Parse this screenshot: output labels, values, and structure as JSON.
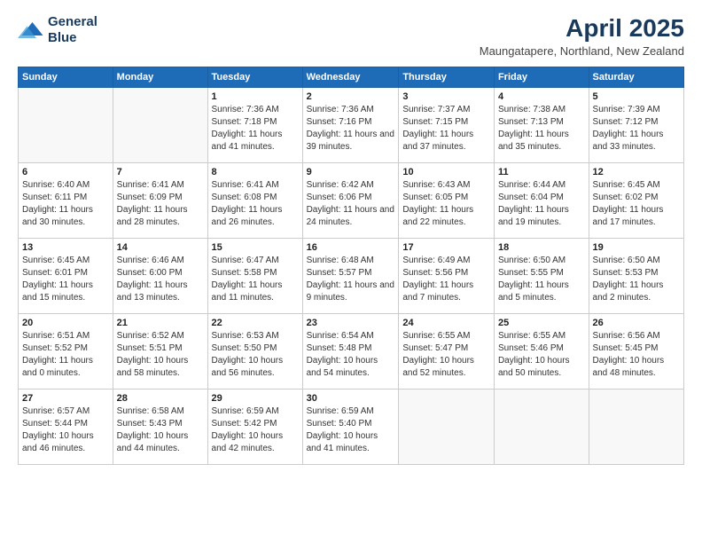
{
  "logo": {
    "line1": "General",
    "line2": "Blue"
  },
  "title": "April 2025",
  "subtitle": "Maungatapere, Northland, New Zealand",
  "headers": [
    "Sunday",
    "Monday",
    "Tuesday",
    "Wednesday",
    "Thursday",
    "Friday",
    "Saturday"
  ],
  "weeks": [
    [
      {
        "day": "",
        "info": ""
      },
      {
        "day": "",
        "info": ""
      },
      {
        "day": "1",
        "info": "Sunrise: 7:36 AM\nSunset: 7:18 PM\nDaylight: 11 hours and 41 minutes."
      },
      {
        "day": "2",
        "info": "Sunrise: 7:36 AM\nSunset: 7:16 PM\nDaylight: 11 hours and 39 minutes."
      },
      {
        "day": "3",
        "info": "Sunrise: 7:37 AM\nSunset: 7:15 PM\nDaylight: 11 hours and 37 minutes."
      },
      {
        "day": "4",
        "info": "Sunrise: 7:38 AM\nSunset: 7:13 PM\nDaylight: 11 hours and 35 minutes."
      },
      {
        "day": "5",
        "info": "Sunrise: 7:39 AM\nSunset: 7:12 PM\nDaylight: 11 hours and 33 minutes."
      }
    ],
    [
      {
        "day": "6",
        "info": "Sunrise: 6:40 AM\nSunset: 6:11 PM\nDaylight: 11 hours and 30 minutes."
      },
      {
        "day": "7",
        "info": "Sunrise: 6:41 AM\nSunset: 6:09 PM\nDaylight: 11 hours and 28 minutes."
      },
      {
        "day": "8",
        "info": "Sunrise: 6:41 AM\nSunset: 6:08 PM\nDaylight: 11 hours and 26 minutes."
      },
      {
        "day": "9",
        "info": "Sunrise: 6:42 AM\nSunset: 6:06 PM\nDaylight: 11 hours and 24 minutes."
      },
      {
        "day": "10",
        "info": "Sunrise: 6:43 AM\nSunset: 6:05 PM\nDaylight: 11 hours and 22 minutes."
      },
      {
        "day": "11",
        "info": "Sunrise: 6:44 AM\nSunset: 6:04 PM\nDaylight: 11 hours and 19 minutes."
      },
      {
        "day": "12",
        "info": "Sunrise: 6:45 AM\nSunset: 6:02 PM\nDaylight: 11 hours and 17 minutes."
      }
    ],
    [
      {
        "day": "13",
        "info": "Sunrise: 6:45 AM\nSunset: 6:01 PM\nDaylight: 11 hours and 15 minutes."
      },
      {
        "day": "14",
        "info": "Sunrise: 6:46 AM\nSunset: 6:00 PM\nDaylight: 11 hours and 13 minutes."
      },
      {
        "day": "15",
        "info": "Sunrise: 6:47 AM\nSunset: 5:58 PM\nDaylight: 11 hours and 11 minutes."
      },
      {
        "day": "16",
        "info": "Sunrise: 6:48 AM\nSunset: 5:57 PM\nDaylight: 11 hours and 9 minutes."
      },
      {
        "day": "17",
        "info": "Sunrise: 6:49 AM\nSunset: 5:56 PM\nDaylight: 11 hours and 7 minutes."
      },
      {
        "day": "18",
        "info": "Sunrise: 6:50 AM\nSunset: 5:55 PM\nDaylight: 11 hours and 5 minutes."
      },
      {
        "day": "19",
        "info": "Sunrise: 6:50 AM\nSunset: 5:53 PM\nDaylight: 11 hours and 2 minutes."
      }
    ],
    [
      {
        "day": "20",
        "info": "Sunrise: 6:51 AM\nSunset: 5:52 PM\nDaylight: 11 hours and 0 minutes."
      },
      {
        "day": "21",
        "info": "Sunrise: 6:52 AM\nSunset: 5:51 PM\nDaylight: 10 hours and 58 minutes."
      },
      {
        "day": "22",
        "info": "Sunrise: 6:53 AM\nSunset: 5:50 PM\nDaylight: 10 hours and 56 minutes."
      },
      {
        "day": "23",
        "info": "Sunrise: 6:54 AM\nSunset: 5:48 PM\nDaylight: 10 hours and 54 minutes."
      },
      {
        "day": "24",
        "info": "Sunrise: 6:55 AM\nSunset: 5:47 PM\nDaylight: 10 hours and 52 minutes."
      },
      {
        "day": "25",
        "info": "Sunrise: 6:55 AM\nSunset: 5:46 PM\nDaylight: 10 hours and 50 minutes."
      },
      {
        "day": "26",
        "info": "Sunrise: 6:56 AM\nSunset: 5:45 PM\nDaylight: 10 hours and 48 minutes."
      }
    ],
    [
      {
        "day": "27",
        "info": "Sunrise: 6:57 AM\nSunset: 5:44 PM\nDaylight: 10 hours and 46 minutes."
      },
      {
        "day": "28",
        "info": "Sunrise: 6:58 AM\nSunset: 5:43 PM\nDaylight: 10 hours and 44 minutes."
      },
      {
        "day": "29",
        "info": "Sunrise: 6:59 AM\nSunset: 5:42 PM\nDaylight: 10 hours and 42 minutes."
      },
      {
        "day": "30",
        "info": "Sunrise: 6:59 AM\nSunset: 5:40 PM\nDaylight: 10 hours and 41 minutes."
      },
      {
        "day": "",
        "info": ""
      },
      {
        "day": "",
        "info": ""
      },
      {
        "day": "",
        "info": ""
      }
    ]
  ]
}
